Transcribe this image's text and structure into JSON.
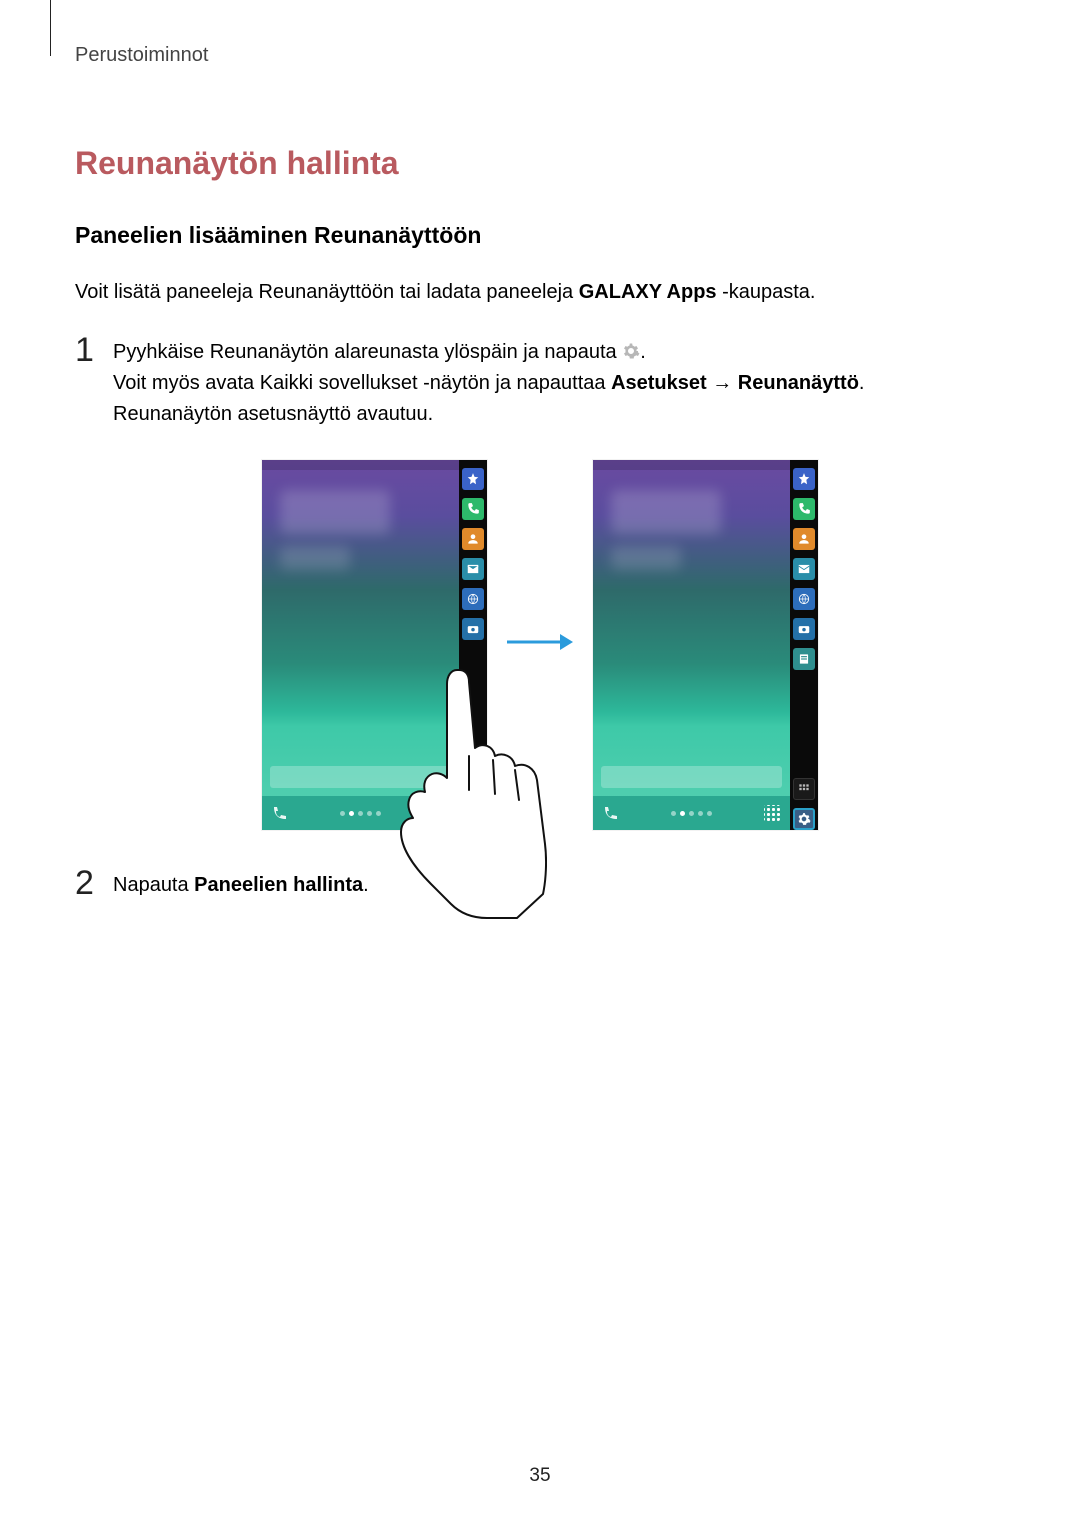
{
  "header": {
    "section": "Perustoiminnot"
  },
  "h1": "Reunanäytön hallinta",
  "h2": "Paneelien lisääminen Reunanäyttöön",
  "intro_before": "Voit lisätä paneeleja Reunanäyttöön tai ladata paneeleja ",
  "intro_bold": "GALAXY Apps",
  "intro_after": " -kaupasta.",
  "steps": [
    {
      "num": "1",
      "line1_before": "Pyyhkäise Reunanäytön alareunasta ylöspäin ja napauta ",
      "line1_after": ".",
      "line2_before": "Voit myös avata Kaikki sovellukset -näytön ja napauttaa ",
      "line2_bold1": "Asetukset",
      "line2_arrow": " → ",
      "line2_bold2": "Reunanäyttö",
      "line2_after": ".",
      "line3": "Reunanäytön asetusnäyttö avautuu."
    },
    {
      "num": "2",
      "line1_before": "Napauta ",
      "line1_bold": "Paneelien hallinta",
      "line1_after": "."
    }
  ],
  "icons": {
    "gear": "gear-icon",
    "edge_items_left": [
      "star",
      "phone",
      "contact",
      "mail",
      "globe",
      "camera"
    ],
    "edge_items_right": [
      "star",
      "phone",
      "contact",
      "mail",
      "globe",
      "camera",
      "note"
    ]
  },
  "page_number": "35"
}
